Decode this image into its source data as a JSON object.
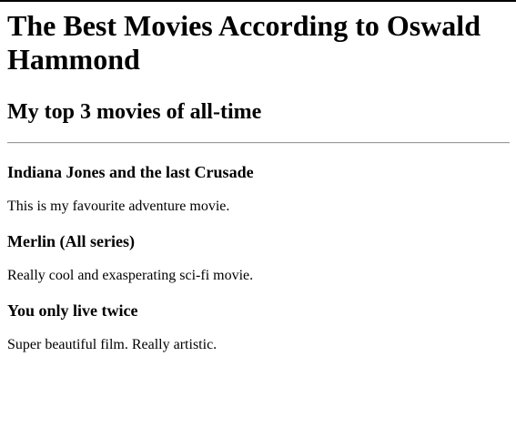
{
  "page": {
    "title": "The Best Movies According to Oswald Hammond",
    "subtitle": "My top 3 movies of all-time"
  },
  "movies": [
    {
      "title": "Indiana Jones and the last Crusade",
      "description": "This is my favourite adventure movie."
    },
    {
      "title": "Merlin (All series)",
      "description": "Really cool and exasperating sci-fi movie."
    },
    {
      "title": "You only live twice",
      "description": "Super beautiful film. Really artistic."
    }
  ]
}
